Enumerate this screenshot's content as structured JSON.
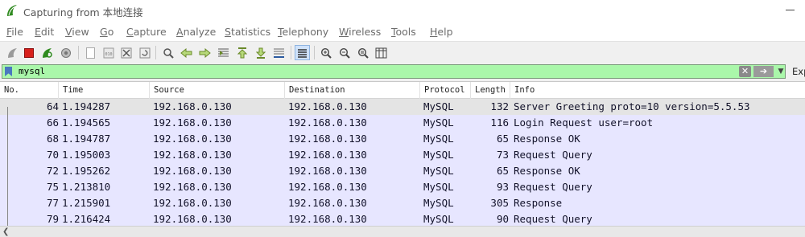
{
  "window": {
    "title": "Capturing from 本地连接"
  },
  "menu": [
    "File",
    "Edit",
    "View",
    "Go",
    "Capture",
    "Analyze",
    "Statistics",
    "Telephony",
    "Wireless",
    "Tools",
    "Help"
  ],
  "toolbar_icons": [
    "shark-fin-start-icon",
    "stop-icon",
    "restart-icon",
    "options-gear-icon",
    "open-file-icon",
    "save-file-icon",
    "close-file-icon",
    "reload-icon",
    "find-icon",
    "back-arrow-icon",
    "forward-arrow-icon",
    "go-to-packet-icon",
    "first-packet-icon",
    "last-packet-icon",
    "autoscroll-icon",
    "colorize-icon",
    "zoom-in-icon",
    "zoom-out-icon",
    "normal-size-icon",
    "resize-columns-icon"
  ],
  "filter": {
    "value": "mysql",
    "expression_label": "Exp"
  },
  "columns": [
    "No.",
    "Time",
    "Source",
    "Destination",
    "Protocol",
    "Length",
    "Info"
  ],
  "packets": [
    {
      "no": "64",
      "time": "1.194287",
      "source": "192.168.0.130",
      "destination": "192.168.0.130",
      "protocol": "MySQL",
      "length": "132",
      "info": "Server Greeting proto=10 version=5.5.53"
    },
    {
      "no": "66",
      "time": "1.194565",
      "source": "192.168.0.130",
      "destination": "192.168.0.130",
      "protocol": "MySQL",
      "length": "116",
      "info": "Login Request user=root"
    },
    {
      "no": "68",
      "time": "1.194787",
      "source": "192.168.0.130",
      "destination": "192.168.0.130",
      "protocol": "MySQL",
      "length": "65",
      "info": "Response OK"
    },
    {
      "no": "70",
      "time": "1.195003",
      "source": "192.168.0.130",
      "destination": "192.168.0.130",
      "protocol": "MySQL",
      "length": "73",
      "info": "Request Query"
    },
    {
      "no": "72",
      "time": "1.195262",
      "source": "192.168.0.130",
      "destination": "192.168.0.130",
      "protocol": "MySQL",
      "length": "65",
      "info": "Response OK"
    },
    {
      "no": "75",
      "time": "1.213810",
      "source": "192.168.0.130",
      "destination": "192.168.0.130",
      "protocol": "MySQL",
      "length": "93",
      "info": "Request Query"
    },
    {
      "no": "77",
      "time": "1.215901",
      "source": "192.168.0.130",
      "destination": "192.168.0.130",
      "protocol": "MySQL",
      "length": "305",
      "info": "Response"
    },
    {
      "no": "79",
      "time": "1.216424",
      "source": "192.168.0.130",
      "destination": "192.168.0.130",
      "protocol": "MySQL",
      "length": "90",
      "info": "Request Query"
    }
  ],
  "colors": {
    "filter_valid_bg": "#aaf7aa",
    "row_bg": "#e7e6ff",
    "selected_row_bg": "#e4e4e4"
  }
}
